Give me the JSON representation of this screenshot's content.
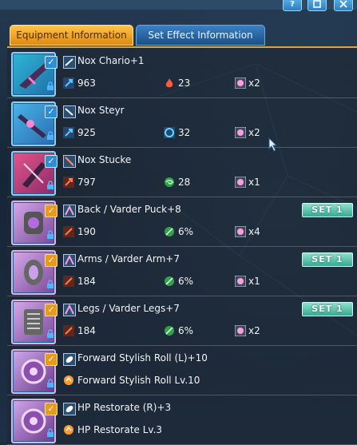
{
  "window": {
    "help_label": "?",
    "buttons": [
      "help",
      "minimize",
      "close"
    ]
  },
  "tabs": [
    {
      "label": "Equipment Information",
      "active": true
    },
    {
      "label": "Set Effect Information",
      "active": false
    }
  ],
  "items": [
    {
      "name": "Nox Chario+1",
      "kind": "weapon",
      "atk": "963",
      "elem_value": "23",
      "elem_icon": "fire-icon",
      "slot": "x2",
      "set": ""
    },
    {
      "name": "Nox Steyr",
      "kind": "weapon",
      "atk": "925",
      "elem_value": "32",
      "elem_icon": "ice-icon",
      "slot": "x2",
      "set": ""
    },
    {
      "name": "Nox Stucke",
      "kind": "weapon",
      "atk": "797",
      "elem_value": "28",
      "elem_icon": "wind-icon",
      "slot": "x1",
      "set": ""
    },
    {
      "name": "Back / Varder Puck+8",
      "kind": "unit",
      "def": "190",
      "res": "6%",
      "slot": "x4",
      "set": "SET 1"
    },
    {
      "name": "Arms / Varder Arm+7",
      "kind": "unit",
      "def": "184",
      "res": "6%",
      "slot": "x1",
      "set": "SET 1"
    },
    {
      "name": "Legs / Varder Legs+7",
      "kind": "unit",
      "def": "184",
      "res": "6%",
      "slot": "x2",
      "set": "SET 1"
    },
    {
      "name": "Forward Stylish Roll (L)+10",
      "kind": "skill",
      "detail": "Forward Stylish Roll Lv.10"
    },
    {
      "name": "HP Restorate (R)+3",
      "kind": "skill",
      "detail": "HP Restorate Lv.3"
    }
  ],
  "colors": {
    "tab_active": "#f0a52a",
    "tab_inactive": "#2a6aa8",
    "set_badge": "#5cc4ad",
    "check_blue": "#2e8dd6",
    "check_gold": "#e79a1b"
  }
}
